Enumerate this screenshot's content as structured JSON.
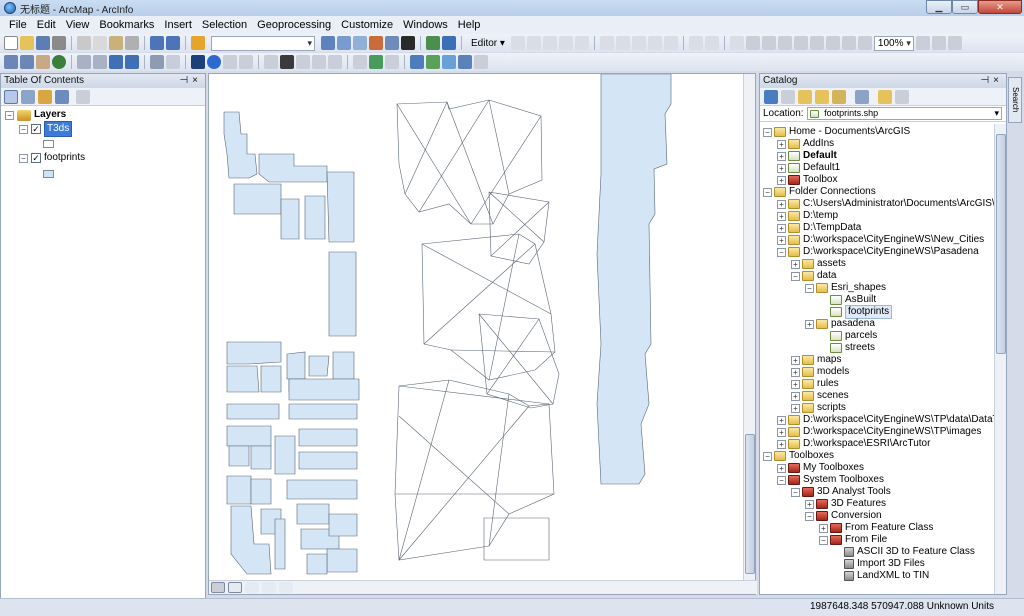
{
  "window": {
    "title": "无标题 - ArcMap - ArcInfo"
  },
  "menu": [
    "File",
    "Edit",
    "View",
    "Bookmarks",
    "Insert",
    "Selection",
    "Geoprocessing",
    "Customize",
    "Windows",
    "Help"
  ],
  "toolbar": {
    "editor_label": "Editor ▾",
    "zoom_value": "100%"
  },
  "toc": {
    "title": "Table Of Contents",
    "root": "Layers",
    "layers": [
      {
        "name": "T3ds",
        "checked": true,
        "selected": true
      },
      {
        "name": "footprints",
        "checked": true,
        "selected": false
      }
    ]
  },
  "catalog": {
    "title": "Catalog",
    "location_label": "Location:",
    "location_value": "footprints.shp",
    "side_tab": "Search",
    "items": [
      "Home - Documents\\ArcGIS",
      "AddIns",
      "Default",
      "Default1",
      "Toolbox",
      "Folder Connections",
      "C:\\Users\\Administrator\\Documents\\ArcGIS\\",
      "D:\\temp",
      "D:\\TempData",
      "D:\\workspace\\CityEngineWS\\New_Cities",
      "D:\\workspace\\CityEngineWS\\Pasadena",
      "assets",
      "data",
      "Esri_shapes",
      "AsBuilt",
      "footprints",
      "pasadena",
      "parcels",
      "streets",
      "maps",
      "models",
      "rules",
      "scenes",
      "scripts",
      "D:\\workspace\\CityEngineWS\\TP\\data\\DataToE",
      "D:\\workspace\\CityEngineWS\\TP\\images",
      "D:\\workspace\\ESRI\\ArcTutor",
      "Toolboxes",
      "My Toolboxes",
      "System Toolboxes",
      "3D Analyst Tools",
      "3D Features",
      "Conversion",
      "From Feature Class",
      "From File",
      "ASCII 3D to Feature Class",
      "Import 3D Files",
      "LandXML to TIN"
    ]
  },
  "status": {
    "coords": "1987648.348  570947.088 Unknown Units"
  }
}
